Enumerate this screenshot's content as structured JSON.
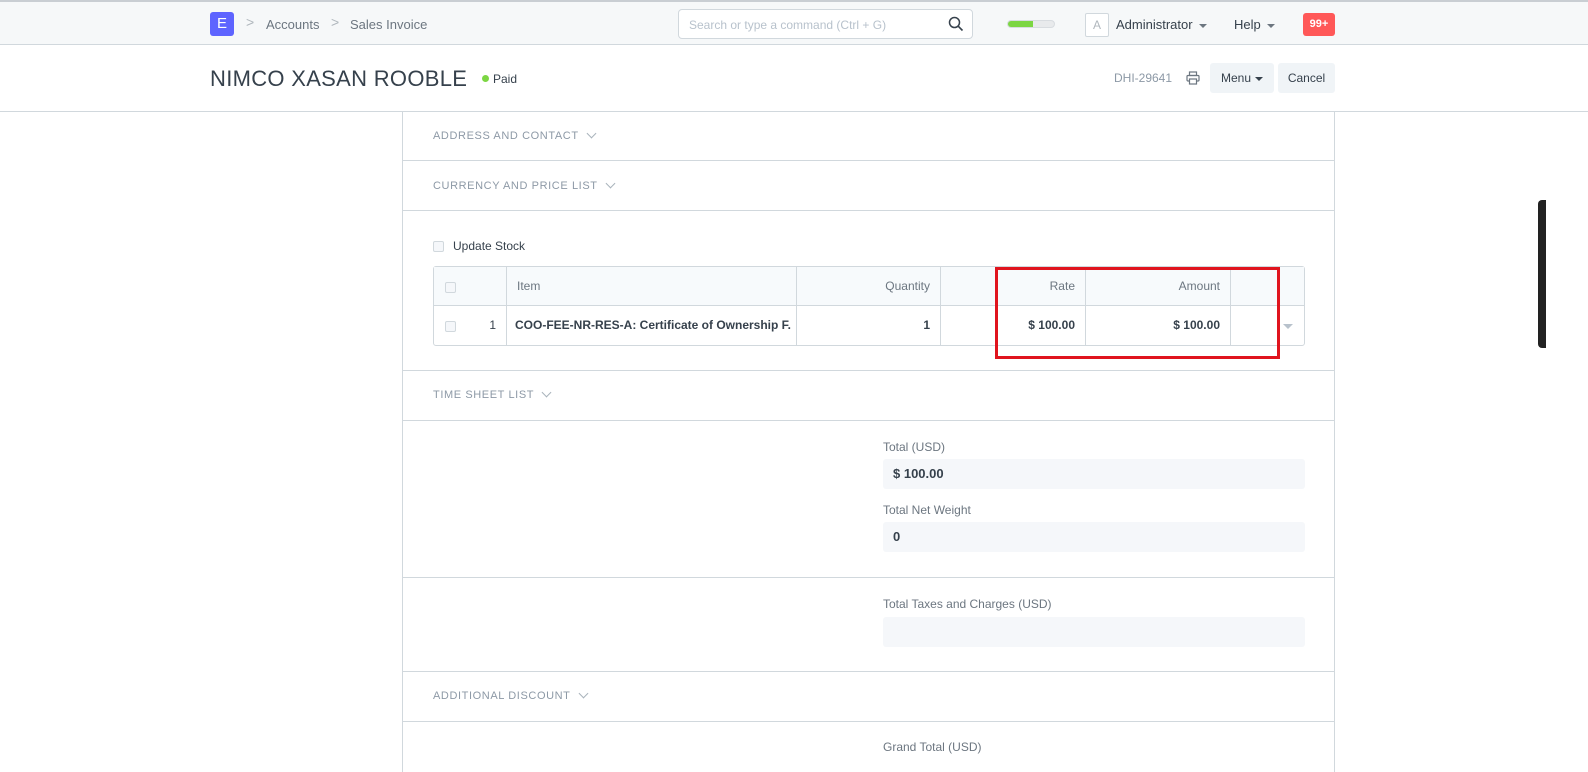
{
  "navbar": {
    "logo": "E",
    "breadcrumbs": [
      "Accounts",
      "Sales Invoice"
    ],
    "search_placeholder": "Search or type a command (Ctrl + G)",
    "progress_fraction": 0.55,
    "avatar_letter": "A",
    "user": "Administrator",
    "help": "Help",
    "notifications": "99+"
  },
  "page": {
    "title": "NIMCO XASAN ROOBLE",
    "status": "Paid",
    "doc_id": "DHI-29641",
    "menu_label": "Menu",
    "cancel_label": "Cancel"
  },
  "sections": {
    "address": "ADDRESS AND CONTACT",
    "currency": "CURRENCY AND PRICE LIST",
    "timesheet": "TIME SHEET LIST",
    "discount": "ADDITIONAL DISCOUNT"
  },
  "update_stock_label": "Update Stock",
  "items_table": {
    "headers": {
      "item": "Item",
      "quantity": "Quantity",
      "rate": "Rate",
      "amount": "Amount"
    },
    "rows": [
      {
        "idx": "1",
        "item": "COO-FEE-NR-RES-A: Certificate of Ownership F...",
        "quantity": "1",
        "rate": "$ 100.00",
        "amount": "$ 100.00"
      }
    ]
  },
  "totals": {
    "total_label": "Total (USD)",
    "total_value": "$ 100.00",
    "net_weight_label": "Total Net Weight",
    "net_weight_value": "0",
    "taxes_label": "Total Taxes and Charges (USD)",
    "taxes_value": "",
    "grand_total_label": "Grand Total (USD)"
  },
  "colors": {
    "brand": "#5e64ff",
    "paid": "#7cd643",
    "highlight": "#e0141e",
    "notification": "#ff5858"
  }
}
